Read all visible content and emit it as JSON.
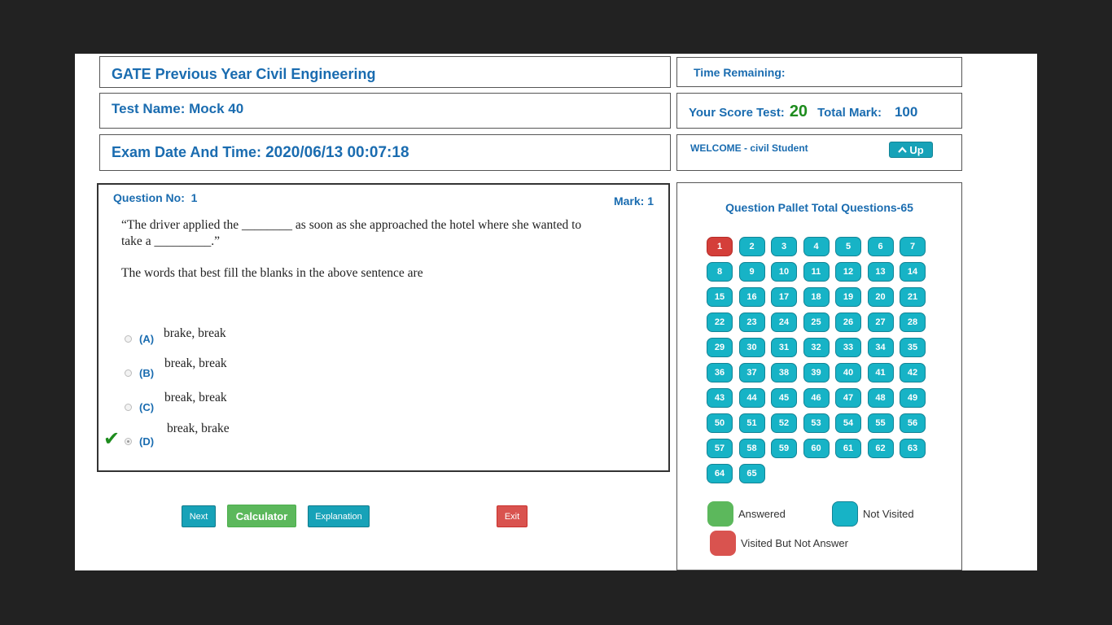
{
  "header": {
    "course_title": "GATE Previous Year Civil Engineering",
    "test_name_label": "Test Name:",
    "test_name_value": "Mock 40",
    "exam_date_label": "Exam Date And Time:",
    "exam_date_value": "2020/06/13 00:07:18"
  },
  "status": {
    "time_remaining_label": "Time Remaining:",
    "score_label": "Your Score Test:",
    "score_value": "20",
    "total_mark_label": "Total Mark:",
    "total_mark_value": "100",
    "welcome_text": "WELCOME - civil Student",
    "up_button_label": "Up"
  },
  "question": {
    "number_label": "Question No:",
    "number_value": "1",
    "mark_label": "Mark: 1",
    "text_line1": "“The driver applied the ________ as soon as she approached the hotel where she wanted to",
    "text_line2": "take a _________.”",
    "prompt": "The words that best fill the blanks in the above sentence are",
    "options": [
      {
        "label": "(A)",
        "text": "brake, break",
        "selected": false
      },
      {
        "label": "(B)",
        "text": "break, break",
        "selected": false
      },
      {
        "label": "(C)",
        "text": "break, break",
        "selected": false
      },
      {
        "label": "(D)",
        "text": "break, brake",
        "selected": true
      }
    ],
    "correct_option": "(D)"
  },
  "buttons": {
    "next": "Next",
    "calculator": "Calculator",
    "explanation": "Explanation",
    "exit": "Exit"
  },
  "pallet": {
    "title": "Question Pallet Total Questions-65",
    "total": 65,
    "current": 1,
    "current_status_color": "#d43f3a",
    "default_status_color": "#17b3c6",
    "legend": {
      "answered": "Answered",
      "not_visited": "Not Visited",
      "visited_not_answer": "Visited But Not Answer"
    }
  }
}
